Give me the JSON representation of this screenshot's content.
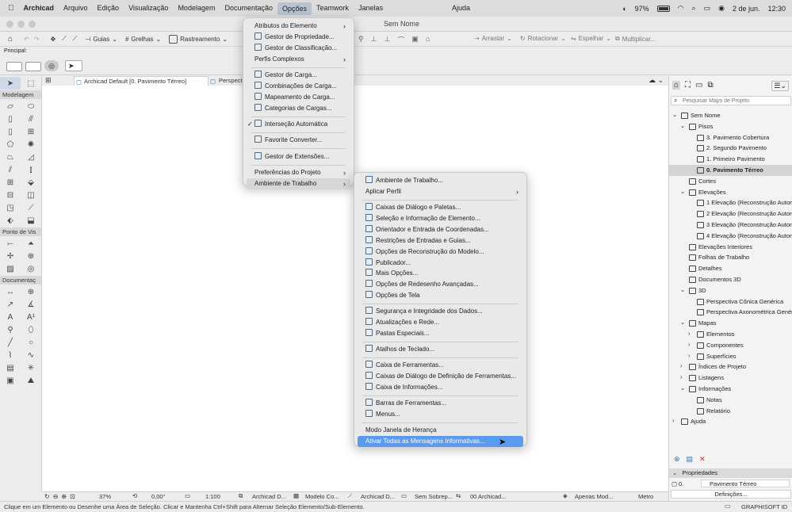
{
  "menubar": {
    "apple": "",
    "app": "Archicad",
    "items": [
      "Arquivo",
      "Edição",
      "Visualização",
      "Modelagem",
      "Documentação",
      "Opções",
      "Teamwork",
      "Janelas"
    ],
    "help": "Ajuda",
    "battery": "97%",
    "date": "2 de jun.",
    "time": "12:30"
  },
  "window": {
    "title": "Sem Nome"
  },
  "toolbar": {
    "guides": "Guias",
    "grids": "Grelhas",
    "tracking": "Rastreamento",
    "drag": "Arrastar",
    "rotate": "Rotacionar",
    "mirror": "Espelhar",
    "multiply": "Multiplicar..."
  },
  "subbar": {
    "principal": "Principal:"
  },
  "toolbox": {
    "modeling": "Modelagem",
    "viewpoint": "Ponto de Vis",
    "documentation": "Documentaç"
  },
  "tabs": {
    "tab1": "Archicad Default [0. Pavimento Térreo]",
    "tab2": "Perspectiv"
  },
  "options_menu": [
    {
      "label": "Atributos do Elemento",
      "sub": true
    },
    {
      "label": "Gestor de Propriedade...",
      "icon": true
    },
    {
      "label": "Gestor de Classificação...",
      "icon": true
    },
    {
      "label": "Perfis Complexos",
      "sub": true
    },
    {
      "sep": true
    },
    {
      "label": "Gestor de Carga...",
      "icon": true
    },
    {
      "label": "Combinações de Carga...",
      "icon": true
    },
    {
      "label": "Mapeamento de Carga...",
      "icon": true
    },
    {
      "label": "Categorias de Cargas...",
      "icon": true
    },
    {
      "sep": true
    },
    {
      "label": "Interseção Automática",
      "icon": true,
      "check": true
    },
    {
      "sep": true
    },
    {
      "label": "Favorite Converter...",
      "icon": true
    },
    {
      "sep": true
    },
    {
      "label": "Gestor de Extensões...",
      "icon": true
    },
    {
      "sep": true
    },
    {
      "label": "Preferências do Projeto",
      "sub": true
    },
    {
      "label": "Ambiente de Trabalho",
      "sub": true,
      "hover": true
    }
  ],
  "work_env_menu": [
    {
      "label": "Ambiente de Trabalho...",
      "icon": true
    },
    {
      "label": "Aplicar Perfil",
      "sub": true
    },
    {
      "sep": true
    },
    {
      "label": "Caixas de Diálogo e Paletas...",
      "icon": true
    },
    {
      "label": "Seleção e Informação de Elemento...",
      "icon": true
    },
    {
      "label": "Orientador e Entrada de Coordenadas...",
      "icon": true
    },
    {
      "label": "Restrições de Entradas e Guias...",
      "icon": true
    },
    {
      "label": "Opções de Reconstrução do Modelo...",
      "icon": true
    },
    {
      "label": "Publicador...",
      "icon": true
    },
    {
      "label": "Mais Opções...",
      "icon": true
    },
    {
      "label": "Opções de Redesenho Avançadas...",
      "icon": true
    },
    {
      "label": "Opções de Tela",
      "icon": true
    },
    {
      "sep": true
    },
    {
      "label": "Segurança e Integridade dos Dados...",
      "icon": true
    },
    {
      "label": "Atualizações e Rede...",
      "icon": true
    },
    {
      "label": "Pastas Especiais...",
      "icon": true
    },
    {
      "sep": true
    },
    {
      "label": "Atalhos de Teclado...",
      "icon": true
    },
    {
      "sep": true
    },
    {
      "label": "Caixa de Ferramentas...",
      "icon": true
    },
    {
      "label": "Caixas de Diálogo de Definição de Ferramentas...",
      "icon": true
    },
    {
      "label": "Caixa de Informações...",
      "icon": true
    },
    {
      "sep": true
    },
    {
      "label": "Barras de Ferramentas...",
      "icon": true
    },
    {
      "label": "Menus...",
      "icon": true
    },
    {
      "sep": true
    },
    {
      "label": "Modo Janela de Herança"
    },
    {
      "label": "Ativar Todas as Mensagens Informativas...",
      "highlight": true
    }
  ],
  "navigator": {
    "search_placeholder": "Pesquisar Maps de Projeto",
    "items": [
      {
        "label": "Sem Nome",
        "level": 0,
        "toggle": "v"
      },
      {
        "label": "Pisos",
        "level": 1,
        "toggle": "v"
      },
      {
        "label": "3. Pavimento Cobertura",
        "level": 2
      },
      {
        "label": "2. Segundo Pavimento",
        "level": 2
      },
      {
        "label": "1. Primeiro Pavimento",
        "level": 2
      },
      {
        "label": "0. Pavimento Térreo",
        "level": 2,
        "selected": true
      },
      {
        "label": "Cortes",
        "level": 1
      },
      {
        "label": "Elevações",
        "level": 1,
        "toggle": "v"
      },
      {
        "label": "1 Elevação (Reconstrução Automática",
        "level": 2
      },
      {
        "label": "2 Elevação (Reconstrução Automática",
        "level": 2
      },
      {
        "label": "3 Elevação (Reconstrução Automática",
        "level": 2
      },
      {
        "label": "4 Elevação (Reconstrução Automática",
        "level": 2
      },
      {
        "label": "Elevações Interiores",
        "level": 1
      },
      {
        "label": "Folhas de Trabalho",
        "level": 1
      },
      {
        "label": "Detalhes",
        "level": 1
      },
      {
        "label": "Documentos 3D",
        "level": 1
      },
      {
        "label": "3D",
        "level": 1,
        "toggle": "v"
      },
      {
        "label": "Perspectiva Cônica Genérica",
        "level": 2
      },
      {
        "label": "Perspectiva Axonométrica Genérica",
        "level": 2
      },
      {
        "label": "Mapas",
        "level": 1,
        "toggle": "v"
      },
      {
        "label": "Elementos",
        "level": 2,
        "toggle": ">"
      },
      {
        "label": "Componentes",
        "level": 2,
        "toggle": ">"
      },
      {
        "label": "Superfícies",
        "level": 2,
        "toggle": ">"
      },
      {
        "label": "Índices de Projeto",
        "level": 1,
        "toggle": ">"
      },
      {
        "label": "Listagens",
        "level": 1,
        "toggle": ">"
      },
      {
        "label": "Informações",
        "level": 1,
        "toggle": "v"
      },
      {
        "label": "Notas",
        "level": 2
      },
      {
        "label": "Relatório",
        "level": 2
      },
      {
        "label": "Ajuda",
        "level": 0,
        "toggle": ">"
      }
    ]
  },
  "properties": {
    "title": "Propriedades",
    "story_num": "0.",
    "story_name": "Pavimento Térreo",
    "settings": "Definições..."
  },
  "bottombar": {
    "zoom": "37%",
    "angle": "0,00°",
    "scale": "1:100",
    "layer": "Archicad D...",
    "model": "Modelo Co...",
    "pen": "Archicad D...",
    "override": "Sem Sobrep...",
    "reno": "00 Archicad...",
    "mvo": "Apenas Mod...",
    "unit": "Metro"
  },
  "status": {
    "text": "Clique em um Elemento ou Desenhe uma Área de Seleção. Clicar e Mantenha Ctrl+Shift para Alternar Seleção Elemento/Sub-Elemento.",
    "brand": "GRAPHISOFT ID"
  }
}
